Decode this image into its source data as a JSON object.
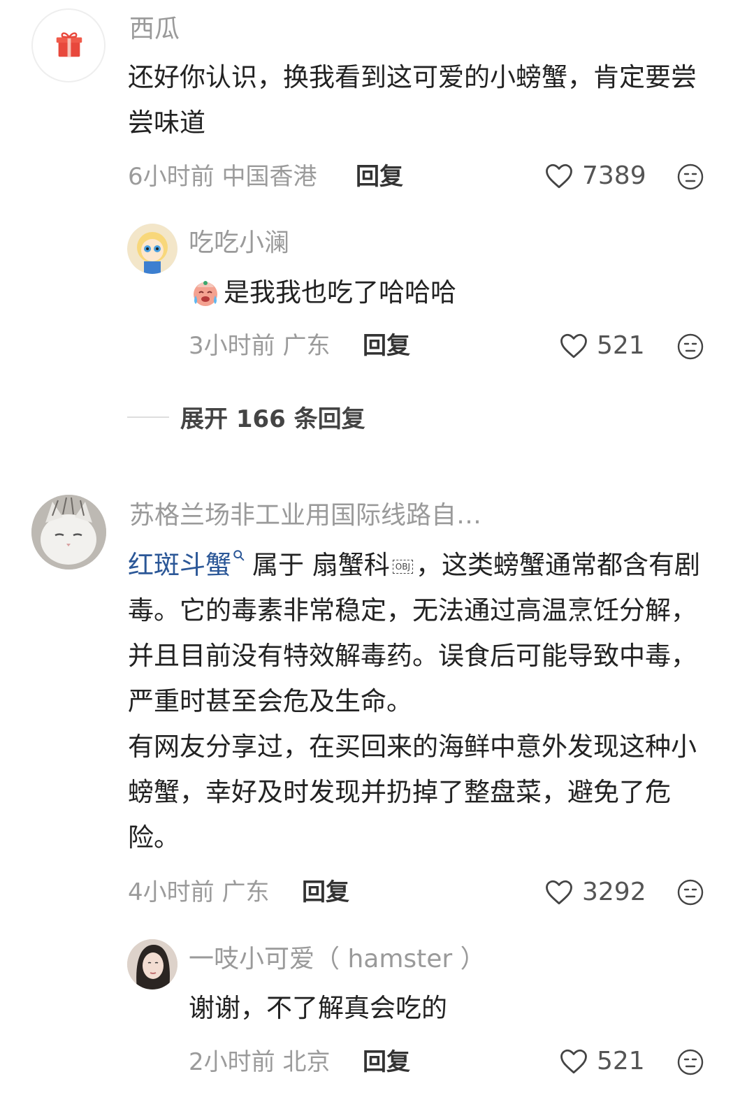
{
  "comments": [
    {
      "username": "西瓜",
      "text": "还好你认识，换我看到这可爱的小螃蟹，肯定要尝尝味道",
      "time_location": "6小时前 中国香港",
      "reply_label": "回复",
      "likes": "7389",
      "avatar_icon": "gift-icon",
      "replies": [
        {
          "username": "吃吃小澜",
          "emoji_icon": "crying-face-icon",
          "text": "是我我也吃了哈哈哈",
          "time_location": "3小时前 广东",
          "reply_label": "回复",
          "likes": "521"
        }
      ],
      "expand_label": "展开 166 条回复"
    },
    {
      "username": "苏格兰场非工业用国际线路自…",
      "topic_link": "红斑斗蟹",
      "search_icon": "search-icon",
      "text_after_link": "属于 扇蟹科",
      "obj_marker": "OBJ",
      "text_rest": "，这类螃蟹通常都含有剧毒。它的毒素非常稳定，无法通过高温烹饪分解，并且目前没有特效解毒药。误食后可能导致中毒，严重时甚至会危及生命。",
      "text_para2": "有网友分享过，在买回来的海鲜中意外发现这种小螃蟹，幸好及时发现并扔掉了整盘菜，避免了危险。",
      "time_location": "4小时前 广东",
      "reply_label": "回复",
      "likes": "3292",
      "replies": [
        {
          "username": "一吱小可爱（ hamster ）",
          "text": "谢谢，不了解真会吃的",
          "time_location": "2小时前 北京",
          "reply_label": "回复",
          "likes": "521"
        }
      ]
    }
  ],
  "colors": {
    "topic_link": "#2b5797",
    "meta": "#9b9b9b",
    "name": "#9a9a9a"
  }
}
